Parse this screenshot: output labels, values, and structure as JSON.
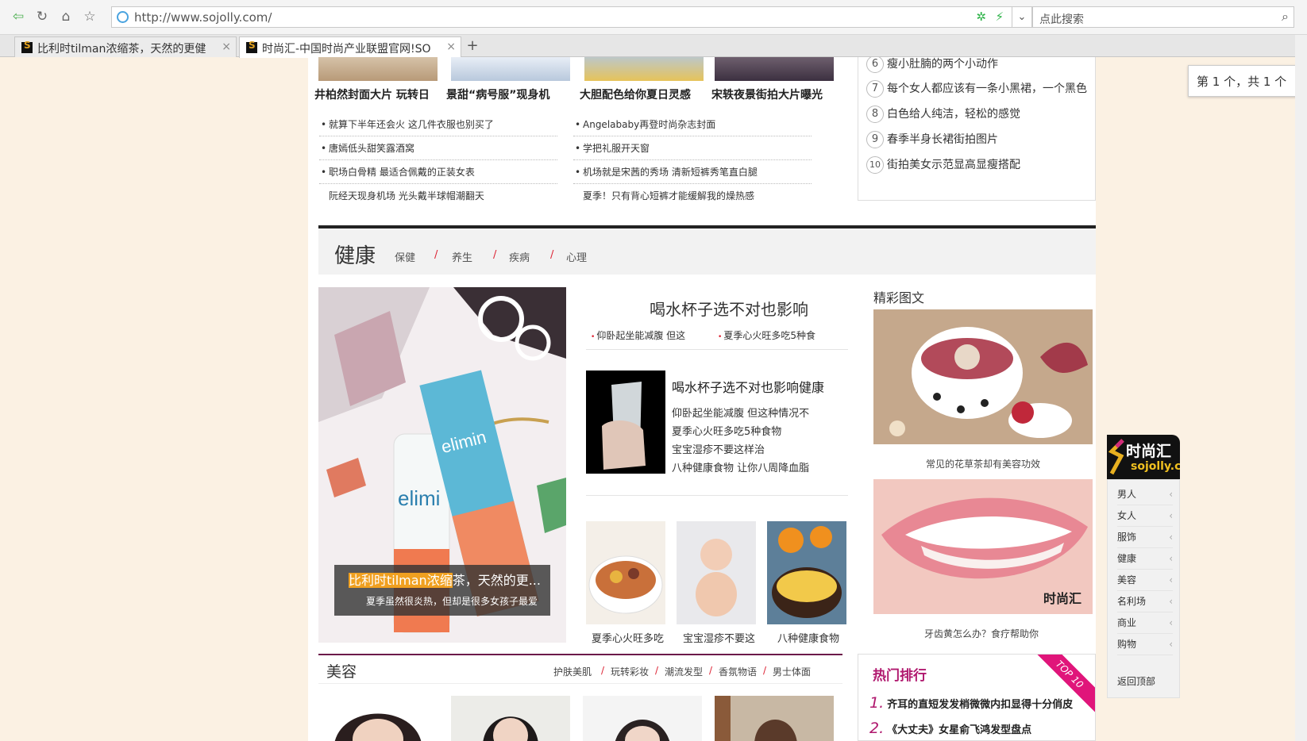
{
  "browser": {
    "url": "http://www.sojolly.com/",
    "search_placeholder": "点此搜索",
    "tabs": [
      {
        "label": "比利时tilman浓缩茶，天然的更健"
      },
      {
        "label": "时尚汇-中国时尚产业联盟官网!SO"
      }
    ],
    "new_tab": "+",
    "find_bar": "第 1 个，共 1 个"
  },
  "top": {
    "captions": [
      "井柏然封面大片 玩转日",
      "景甜“病号服”现身机",
      "大胆配色给你夏日灵感",
      "宋轶夜景街拍大片曝光"
    ],
    "list_left": [
      "就算下半年还会火 这几件衣服也别买了",
      "唐嫣低头甜笑露酒窝",
      "职场白骨精 最适合佩戴的正装女表",
      "阮经天现身机场 光头戴半球帽潮翻天"
    ],
    "list_right": [
      "Angelababy再登时尚杂志封面",
      "学把礼服开天窗",
      "机场就是宋茜的秀场 清新短裤秀笔直白腿",
      "夏季！只有背心短裤才能缓解我的燥热感"
    ],
    "ranking": [
      {
        "n": "6",
        "text": "瘦小肚腩的两个小动作"
      },
      {
        "n": "7",
        "text": "每个女人都应该有一条小黑裙，一个黑色"
      },
      {
        "n": "8",
        "text": "白色给人纯洁，轻松的感觉"
      },
      {
        "n": "9",
        "text": "春季半身长裙街拍图片"
      },
      {
        "n": "10",
        "text": "街拍美女示范显高显瘦搭配"
      }
    ]
  },
  "health": {
    "title": "健康",
    "subs": [
      "保健",
      "养生",
      "疾病",
      "心理"
    ],
    "slash": "/",
    "hero_title_hl": "比利时tilman浓缩",
    "hero_title_rest": "茶，天然的更...",
    "hero_sub": "夏季虽然很炎热，但却是很多女孩子最爱",
    "mid_title": "喝水杯子选不对也影响",
    "mid_links": [
      "仰卧起坐能减腹 但这",
      "夏季心火旺多吃5种食"
    ],
    "glass_title": "喝水杯子选不对也影响健康",
    "glass_lines": [
      "仰卧起坐能减腹 但这种情况不",
      "夏季心火旺多吃5种食物",
      "宝宝湿疹不要这样治",
      "八种健康食物 让你八周降血脂"
    ],
    "food_caps": [
      "夏季心火旺多吃",
      "宝宝湿疹不要这",
      "八种健康食物"
    ],
    "jingcai_title": "精彩图文",
    "jingcai_caps": [
      "常见的花草茶却有美容功效",
      "牙齿黄怎么办？食疗帮助你"
    ]
  },
  "beauty": {
    "title": "美容",
    "subs": [
      "护肤美肌",
      "玩转彩妆",
      "潮流发型",
      "香氛物语",
      "男士体面"
    ]
  },
  "hot": {
    "title": "热门排行",
    "ribbon": "TOP 10",
    "items": [
      {
        "n": "1.",
        "text": "齐耳的直短发发梢微微内扣显得十分俏皮"
      },
      {
        "n": "2.",
        "text": "《大丈夫》女星俞飞鸿发型盘点"
      }
    ]
  },
  "float_nav": {
    "logo": "时尚汇",
    "logo_sub": "sojolly.com",
    "items": [
      "男人",
      "女人",
      "服饰",
      "健康",
      "美容",
      "名利场",
      "商业",
      "购物"
    ],
    "chevron": "‹",
    "back_top": "返回顶部"
  }
}
